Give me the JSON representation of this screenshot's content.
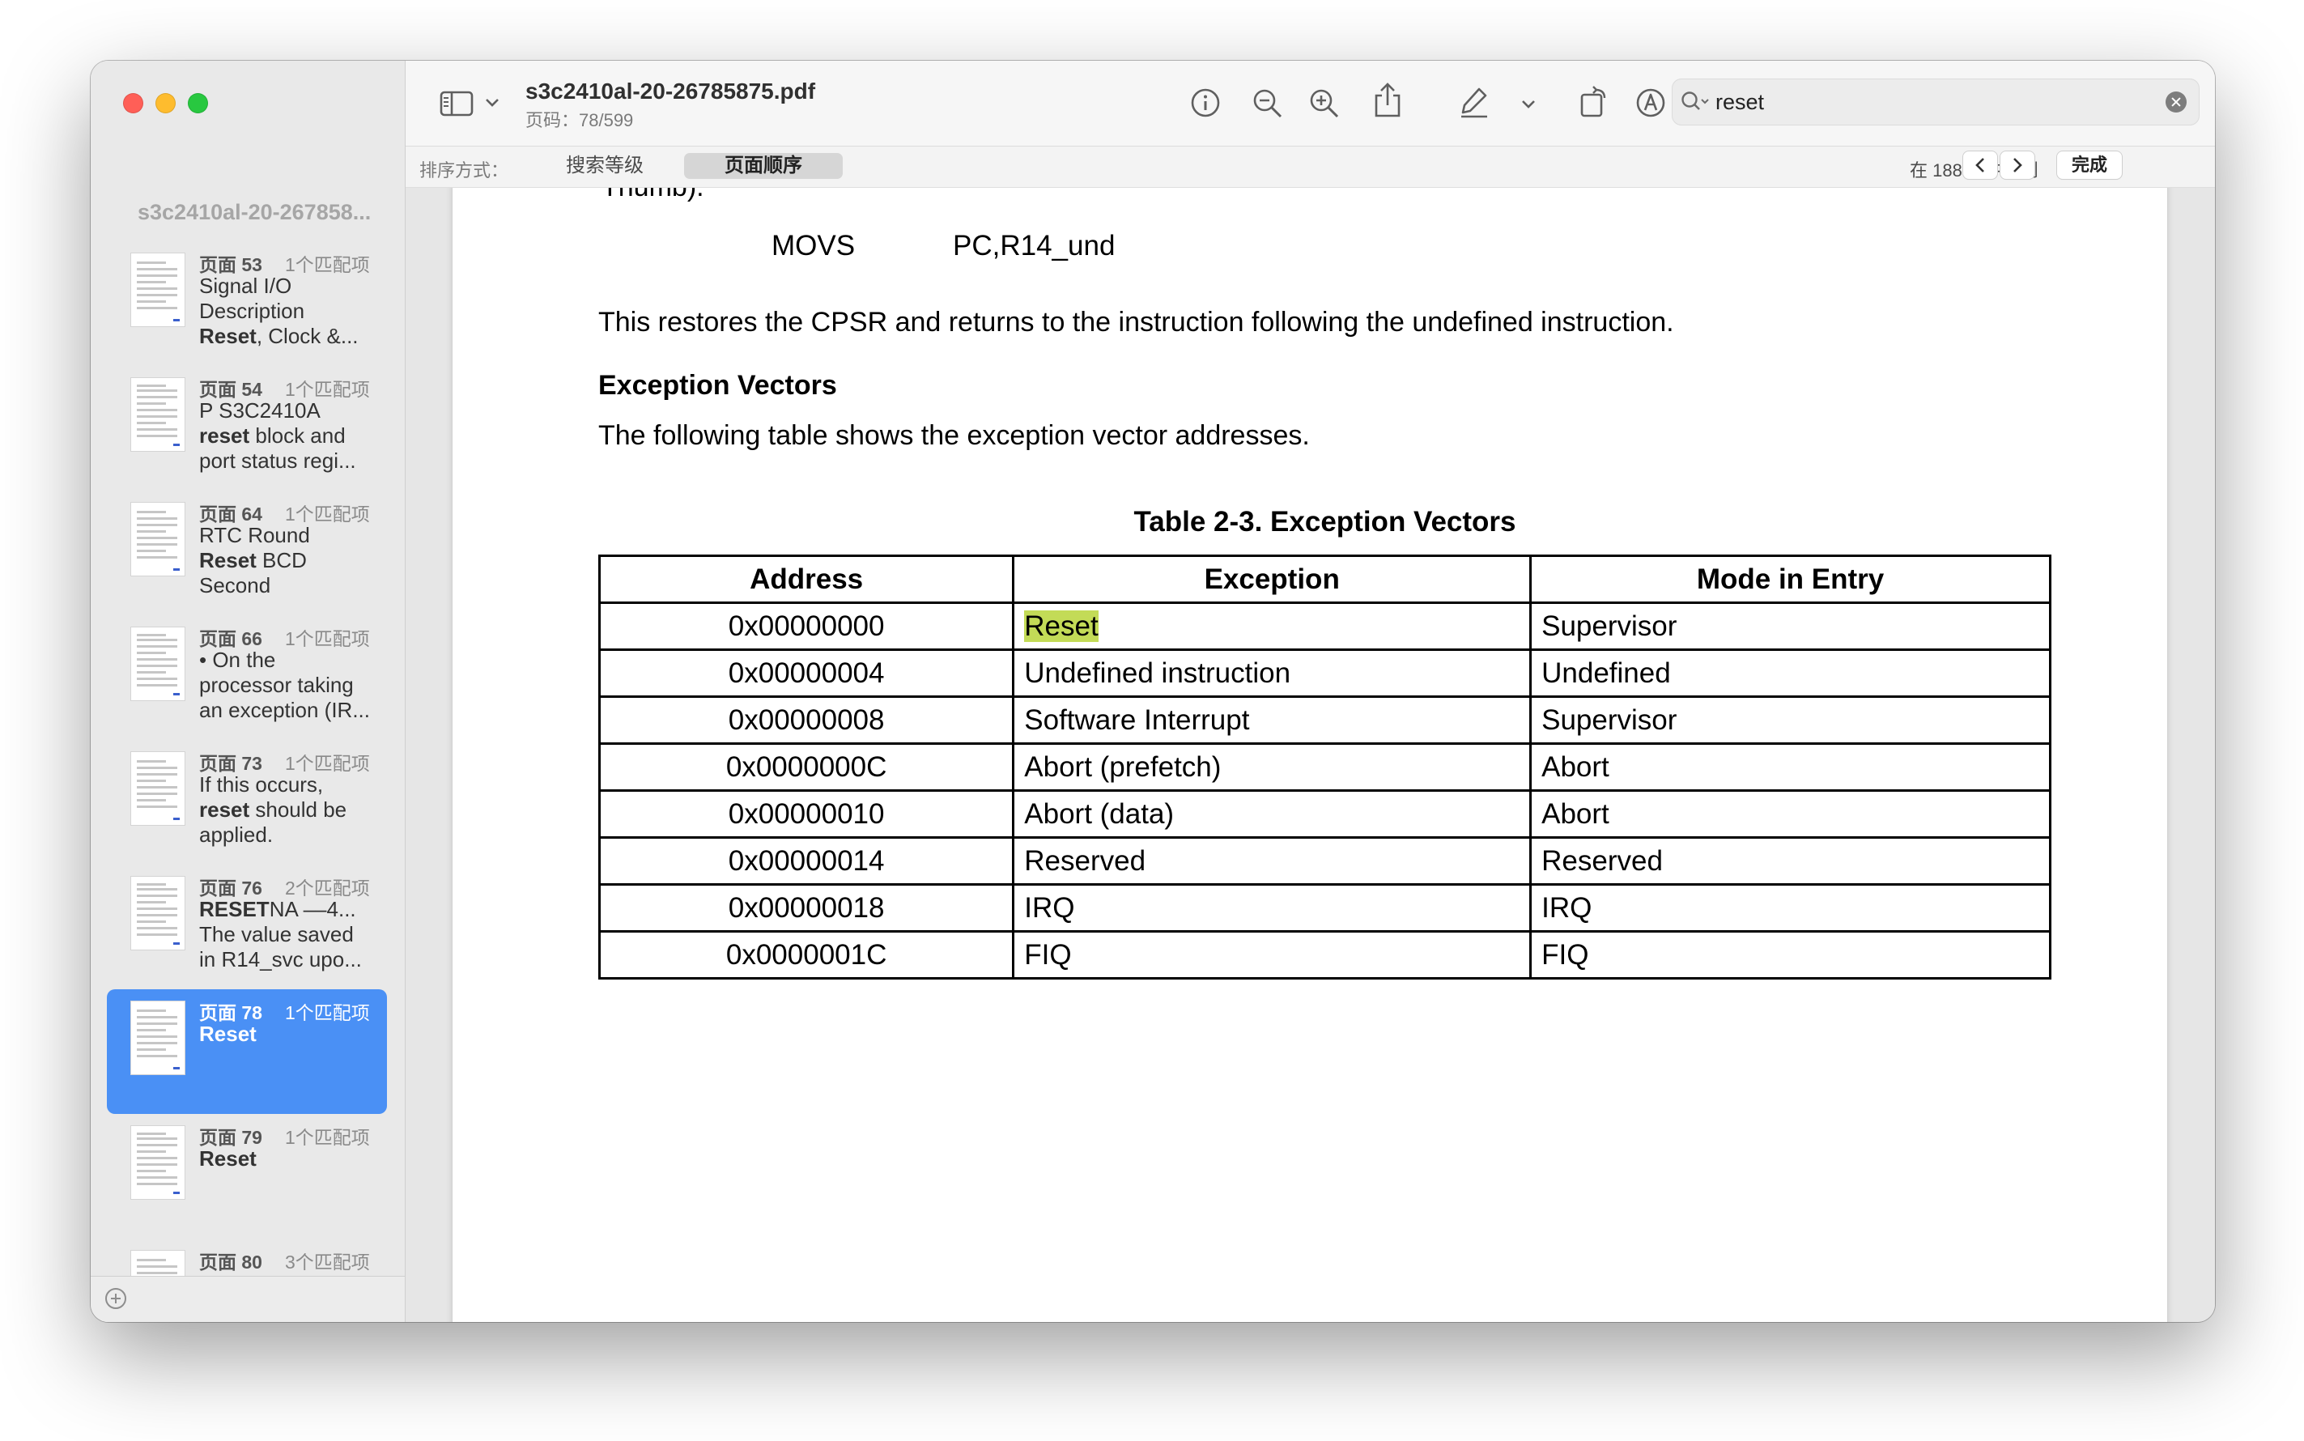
{
  "window": {
    "doc_title": "s3c2410al-20-26785875.pdf",
    "page_indicator": "页码：78/599"
  },
  "sidebar": {
    "title": "s3c2410al-20-267858...",
    "results": [
      {
        "page": "页面 53",
        "matches": "1个匹配项",
        "text": "Signal I/O\nDescription\nReset, Clock &...",
        "highlight": "Reset"
      },
      {
        "page": "页面 54",
        "matches": "1个匹配项",
        "text": "P S3C2410A\nreset block and\nport status regi...",
        "highlight": "reset"
      },
      {
        "page": "页面 64",
        "matches": "1个匹配项",
        "text": "RTC Round\nReset BCD\nSecond",
        "highlight": "Reset"
      },
      {
        "page": "页面 66",
        "matches": "1个匹配项",
        "text": "• On the\nprocessor taking\nan exception (IR..."
      },
      {
        "page": "页面 73",
        "matches": "1个匹配项",
        "text": "If this occurs,\nreset should be\napplied.",
        "highlight": "reset"
      },
      {
        "page": "页面 76",
        "matches": "2个匹配项",
        "text": "RESETNA ––4...\nThe value saved\nin R14_svc upo...",
        "highlight": "RESET"
      },
      {
        "page": "页面 78",
        "matches": "1个匹配项",
        "text": "Reset",
        "highlight": "Reset",
        "selected": true
      },
      {
        "page": "页面 79",
        "matches": "1个匹配项",
        "text": "Reset",
        "highlight": "Reset"
      },
      {
        "page": "页面 80",
        "matches": "3个匹配项",
        "text": ""
      }
    ]
  },
  "toolbar": {
    "icons": [
      "sidebar-toggle-icon",
      "chevron-down-icon",
      "info-icon",
      "zoom-out-icon",
      "zoom-in-icon",
      "share-icon",
      "highlight-pen-icon",
      "chevron-down-icon",
      "rotate-icon",
      "markup-icon",
      "form-fill-icon"
    ]
  },
  "search": {
    "value": "reset",
    "sort_label": "排序方式：",
    "sort_options": [
      "搜索等级",
      "页面顺序"
    ],
    "selected_sort": "页面顺序",
    "found_text": "在 188 页中找到",
    "done_label": "完成"
  },
  "document": {
    "cut_line": "Thumb).",
    "code_mnemonic": "MOVS",
    "code_operands": "PC,R14_und",
    "para1": "This restores the CPSR and returns to the instruction following the undefined instruction.",
    "heading": "Exception Vectors",
    "para2": "The following table shows the exception vector addresses.",
    "table_caption": "Table 2-3. Exception Vectors",
    "table": {
      "headers": [
        "Address",
        "Exception",
        "Mode in Entry"
      ],
      "rows": [
        [
          "0x00000000",
          "Reset",
          "Supervisor"
        ],
        [
          "0x00000004",
          "Undefined instruction",
          "Undefined"
        ],
        [
          "0x00000008",
          "Software Interrupt",
          "Supervisor"
        ],
        [
          "0x0000000C",
          "Abort (prefetch)",
          "Abort"
        ],
        [
          "0x00000010",
          "Abort (data)",
          "Abort"
        ],
        [
          "0x00000014",
          "Reserved",
          "Reserved"
        ],
        [
          "0x00000018",
          "IRQ",
          "IRQ"
        ],
        [
          "0x0000001C",
          "FIQ",
          "FIQ"
        ]
      ]
    },
    "highlight_color": "#c3db57"
  },
  "colors": {
    "selection": "#4a90f5",
    "close": "#ff5f57",
    "minimize": "#febc2e",
    "zoom": "#28c840"
  }
}
